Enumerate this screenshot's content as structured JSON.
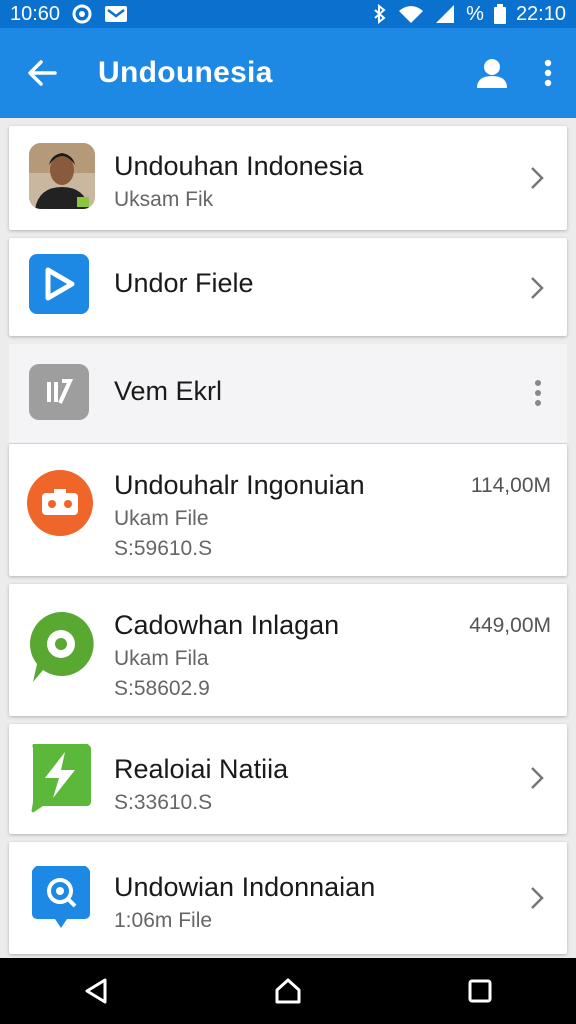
{
  "status_bar": {
    "time": "10:60",
    "battery_text": "%",
    "clock_right": "22:10"
  },
  "app_bar": {
    "title": "Undounesia"
  },
  "items": [
    {
      "title": "Undouhan Indonesia",
      "subtitle": "Uksam Fik",
      "icon": "person-photo"
    },
    {
      "title": "Undor Fiele",
      "icon": "play-icon",
      "color": "#1e88e5"
    },
    {
      "title": "Vem Ekrl",
      "icon": "pause-slash-icon",
      "color": "#9e9e9e"
    },
    {
      "title": "Undouhalr Ingonuian",
      "subtitle": "Ukam File",
      "detail": "S:59610.S",
      "size": "114,00M",
      "icon": "game-controller-icon",
      "color": "#f0652a"
    },
    {
      "title": "Cadowhan Inlagan",
      "subtitle": "Ukam Fila",
      "detail": "S:58602.9",
      "size": "449,00M",
      "icon": "chat-bubble-icon",
      "color": "#58a832"
    },
    {
      "title": "Realoiai Natiia",
      "detail": "S:33610.S",
      "icon": "lightning-icon",
      "color": "#5cb83a"
    },
    {
      "title": "Undowian Indonnaian",
      "subtitle": "1:06m File",
      "icon": "chat-search-icon",
      "color": "#1e88e5"
    }
  ]
}
